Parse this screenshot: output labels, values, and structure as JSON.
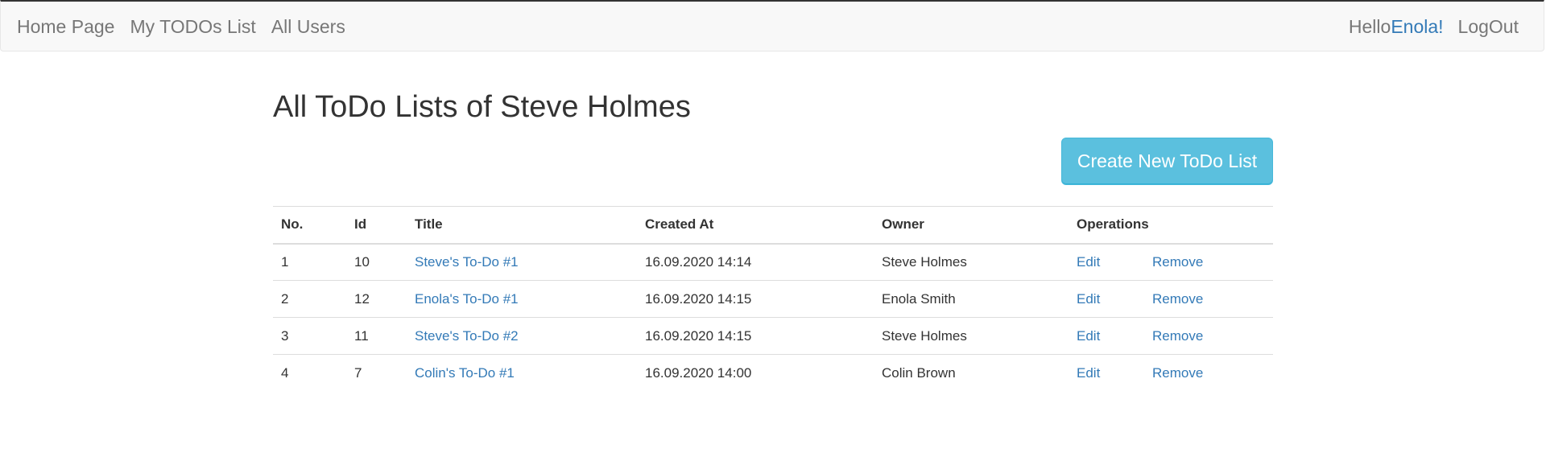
{
  "nav": {
    "links": [
      "Home Page",
      "My TODOs List",
      "All Users"
    ],
    "greeting": "Hello ",
    "user_name": "Enola!",
    "logout": "LogOut"
  },
  "page": {
    "title": "All ToDo Lists of Steve Holmes",
    "create_button": "Create New ToDo List"
  },
  "table": {
    "headers": [
      "No.",
      "Id",
      "Title",
      "Created At",
      "Owner",
      "Operations"
    ],
    "rows": [
      {
        "no": "1",
        "id": "10",
        "title": "Steve's To-Do #1",
        "created": "16.09.2020 14:14",
        "owner": "Steve Holmes",
        "edit": "Edit",
        "remove": "Remove"
      },
      {
        "no": "2",
        "id": "12",
        "title": "Enola's To-Do #1",
        "created": "16.09.2020 14:15",
        "owner": "Enola Smith",
        "edit": "Edit",
        "remove": "Remove"
      },
      {
        "no": "3",
        "id": "11",
        "title": "Steve's To-Do #2",
        "created": "16.09.2020 14:15",
        "owner": "Steve Holmes",
        "edit": "Edit",
        "remove": "Remove"
      },
      {
        "no": "4",
        "id": "7",
        "title": "Colin's To-Do #1",
        "created": "16.09.2020 14:00",
        "owner": "Colin Brown",
        "edit": "Edit",
        "remove": "Remove"
      }
    ]
  }
}
